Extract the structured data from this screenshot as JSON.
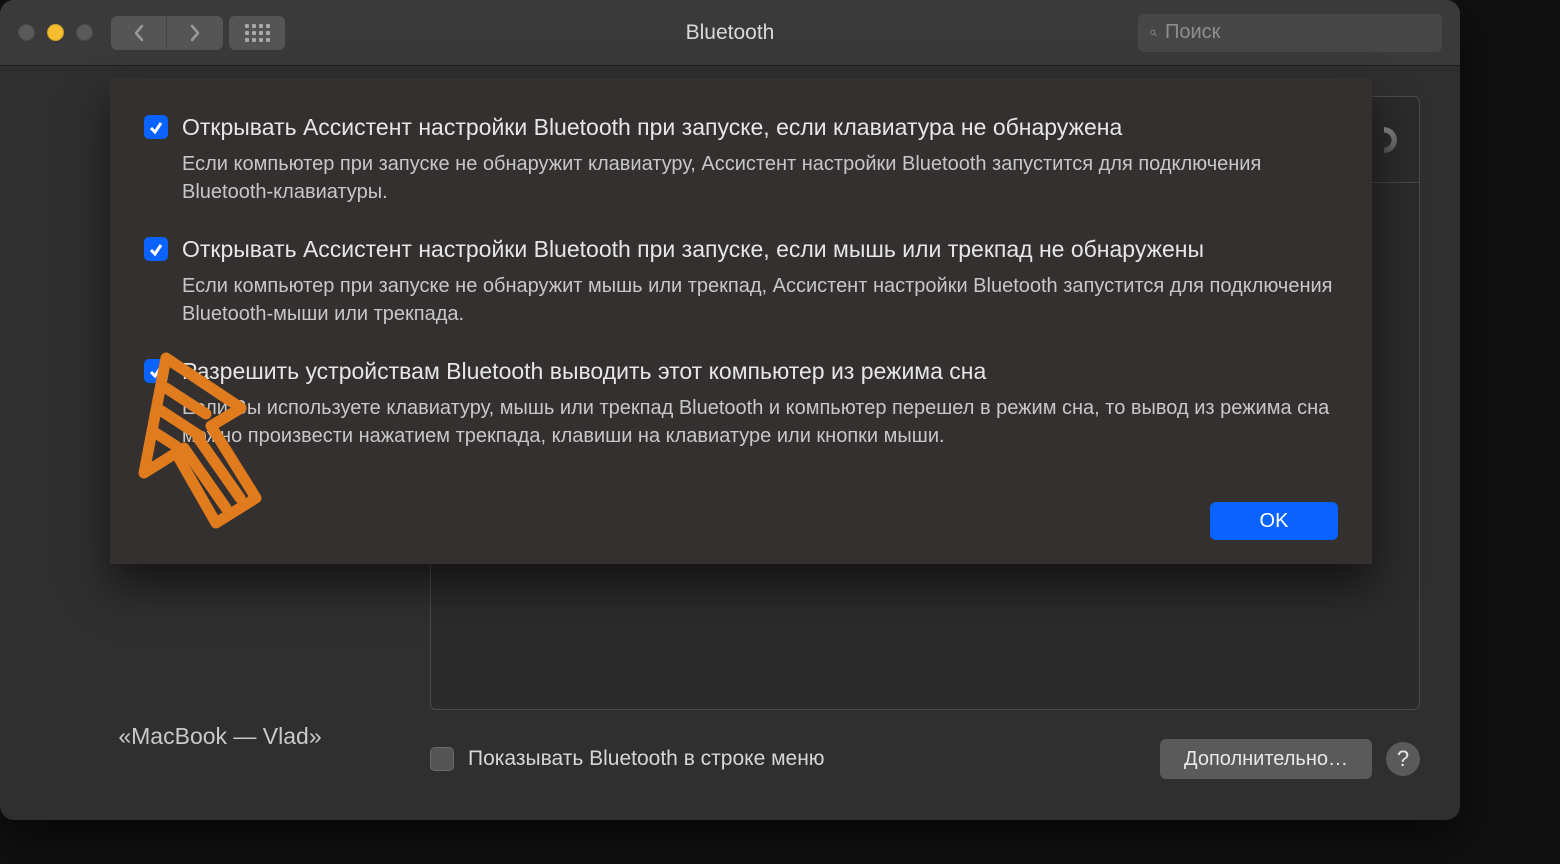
{
  "window": {
    "title": "Bluetooth",
    "search_placeholder": "Поиск"
  },
  "sheet": {
    "options": [
      {
        "checked": true,
        "label": "Открывать Ассистент настройки Bluetooth при запуске, если клавиатура не обнаружена",
        "desc": "Если компьютер при запуске не обнаружит клавиатуру, Ассистент настройки Bluetooth запустится для подключения Bluetooth-клавиатуры."
      },
      {
        "checked": true,
        "label": "Открывать Ассистент настройки Bluetooth при запуске, если мышь или трекпад не обнаружены",
        "desc": "Если компьютер при запуске не обнаружит мышь или трекпад, Ассистент настройки Bluetooth запустится для подключения Bluetooth-мыши или трекпада."
      },
      {
        "checked": true,
        "label": "Разрешить устройствам Bluetooth выводить этот компьютер из режима сна",
        "desc": "Если Вы используете клавиатуру, мышь или трекпад Bluetooth и компьютер перешел в режим сна, то вывод из режима сна можно произвести нажатием трекпада, клавиши на клавиатуре или кнопки мыши."
      }
    ],
    "ok": "OK"
  },
  "main": {
    "device_name": "«MacBook — Vlad»",
    "show_in_menubar_label": "Показывать Bluetooth в строке меню",
    "show_in_menubar_checked": false,
    "advanced_label": "Дополнительно…",
    "help": "?"
  }
}
